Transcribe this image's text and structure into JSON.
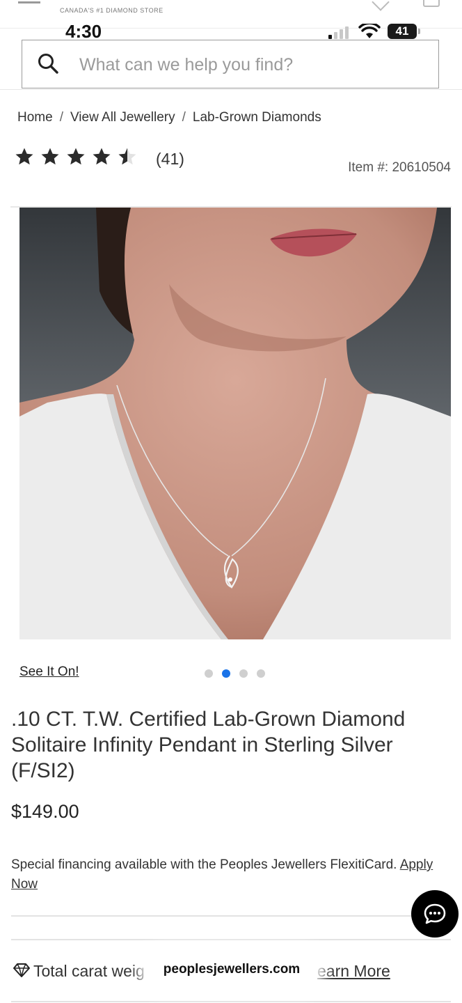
{
  "header": {
    "brand_tagline": "CANADA'S #1 DIAMOND STORE"
  },
  "status_bar": {
    "time": "4:30",
    "battery": "41"
  },
  "search": {
    "placeholder": "What can we help you find?"
  },
  "breadcrumb": {
    "items": [
      "Home",
      "View All Jewellery",
      "Lab-Grown Diamonds"
    ],
    "separator": "/"
  },
  "rating": {
    "stars": 4.5,
    "max": 5,
    "count": "(41)"
  },
  "item_number": "Item #: 20610504",
  "gallery": {
    "see_it_on": "See It On!",
    "slide_count": 4,
    "active_slide": 2
  },
  "product": {
    "title": ".10 CT. T.W. Certified Lab-Grown Diamond Solitaire Infinity Pendant in Sterling Silver (F/SI2)",
    "price": "$149.00"
  },
  "financing": {
    "text": "Special financing available with the Peoples Jewellers FlexitiCard.",
    "link": "Apply Now"
  },
  "details": {
    "carat_label": "Total carat weig",
    "learn_more": "earn More"
  },
  "browser": {
    "url": "peoplesjewellers.com"
  },
  "colors": {
    "accent": "#1a73e8",
    "chat_button": "#000000"
  }
}
